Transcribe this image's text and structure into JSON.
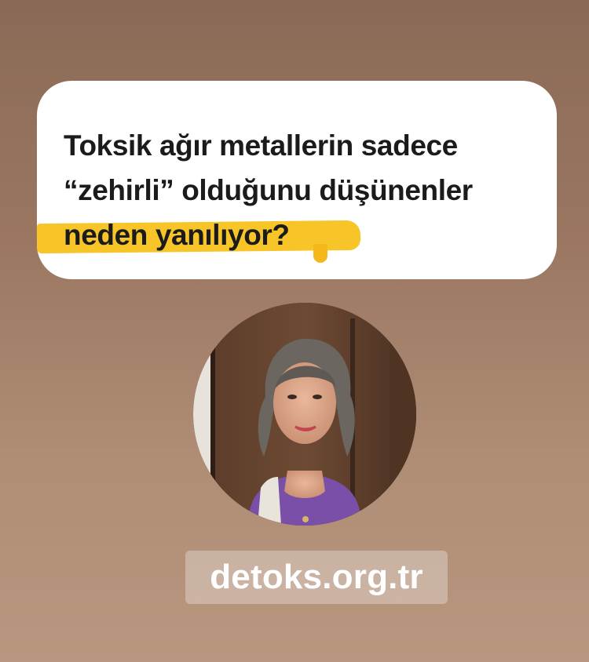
{
  "question": {
    "line1": "Toksik ağır metallerin sadece",
    "line2": "“zehirli” olduğunu düşünenler",
    "line3": "neden yanılıyor?"
  },
  "colors": {
    "highlight": "#f7c21c",
    "background_top": "#8a6a56",
    "background_bottom": "#b8967f"
  },
  "website": {
    "label": "detoks.org.tr"
  }
}
